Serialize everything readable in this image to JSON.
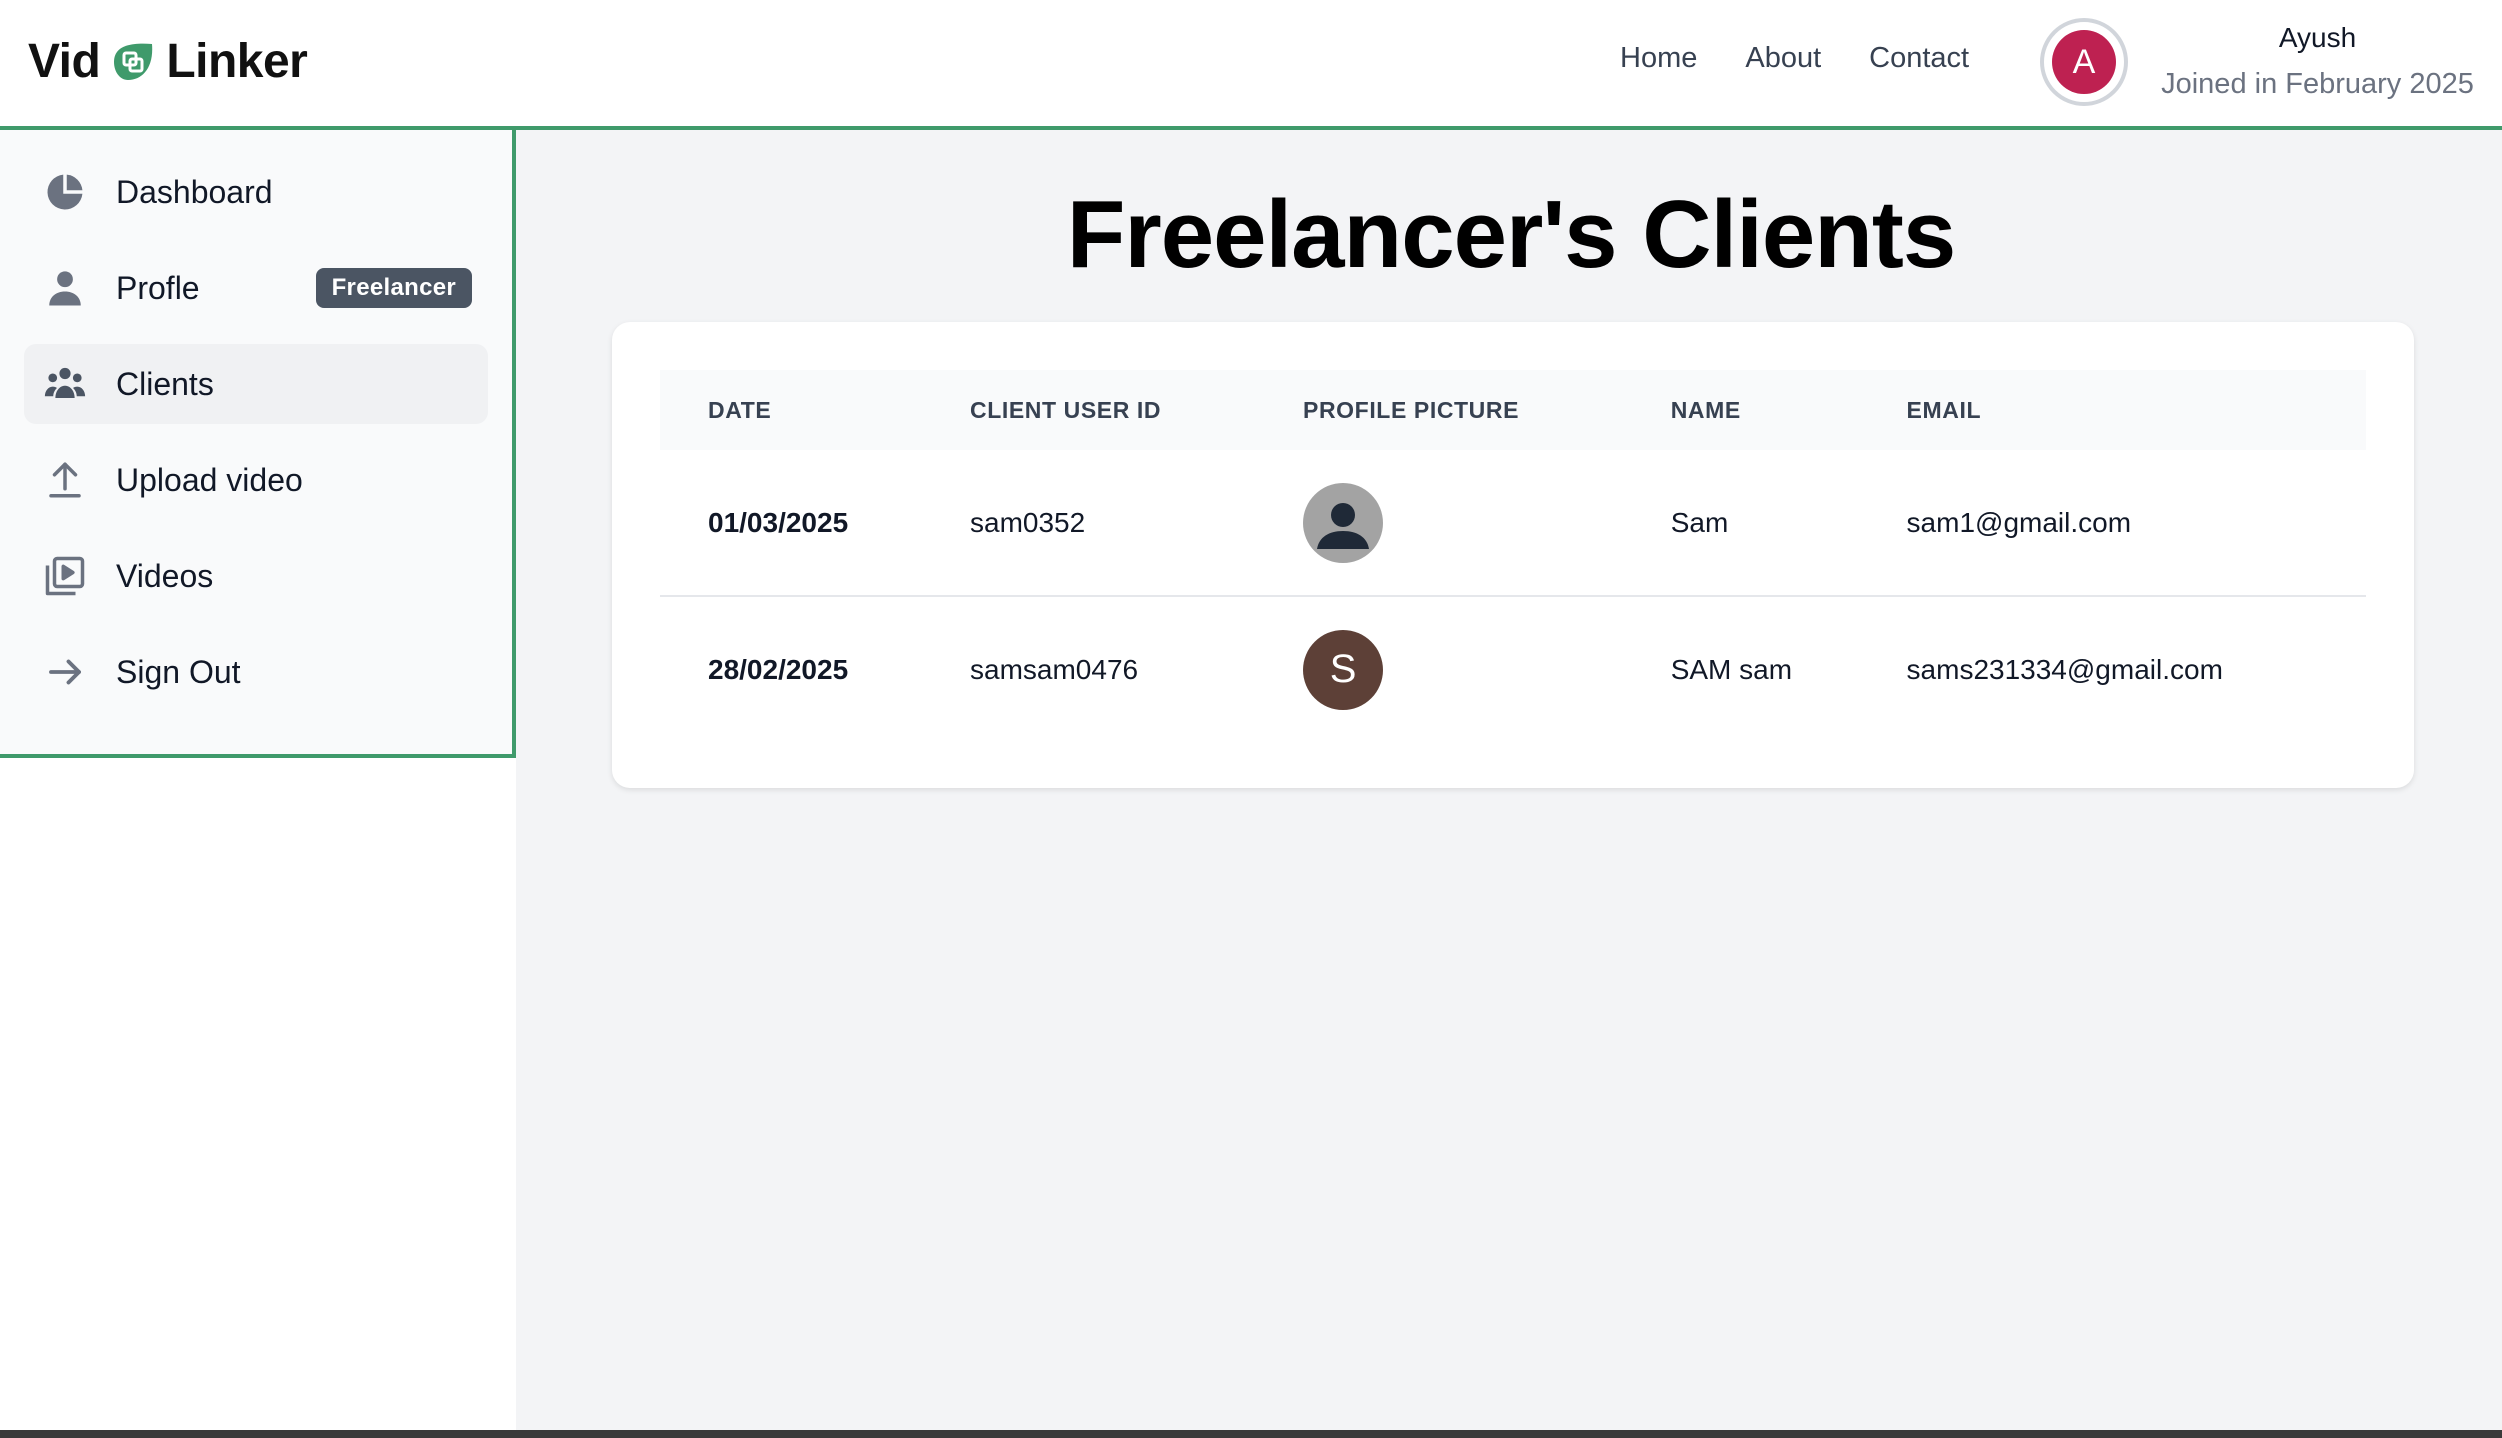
{
  "brand": {
    "left": "Vid",
    "right": "Linker",
    "accent_color": "#3f9a6b"
  },
  "nav": {
    "home": "Home",
    "about": "About",
    "contact": "Contact"
  },
  "user": {
    "initial": "A",
    "name": "Ayush",
    "joined": "Joined in February 2025",
    "avatar_color": "#be2151"
  },
  "sidebar": {
    "items": [
      {
        "label": "Dashboard",
        "icon": "pie-chart-icon"
      },
      {
        "label": "Profle",
        "icon": "user-icon",
        "badge": "Freelancer"
      },
      {
        "label": "Clients",
        "icon": "users-icon",
        "active": true
      },
      {
        "label": "Upload video",
        "icon": "upload-icon"
      },
      {
        "label": "Videos",
        "icon": "video-library-icon"
      },
      {
        "label": "Sign Out",
        "icon": "arrow-right-icon"
      }
    ]
  },
  "main": {
    "title": "Freelancer's Clients",
    "table": {
      "headers": [
        "DATE",
        "CLIENT USER ID",
        "PROFILE PICTURE",
        "NAME",
        "EMAIL"
      ],
      "rows": [
        {
          "date": "01/03/2025",
          "client_user_id": "sam0352",
          "picture": "default-avatar-icon",
          "name": "Sam",
          "email": "sam1@gmail.com"
        },
        {
          "date": "28/02/2025",
          "client_user_id": "samsam0476",
          "picture_letter": "S",
          "name": "SAM sam",
          "email": "sams231334@gmail.com"
        }
      ]
    }
  }
}
